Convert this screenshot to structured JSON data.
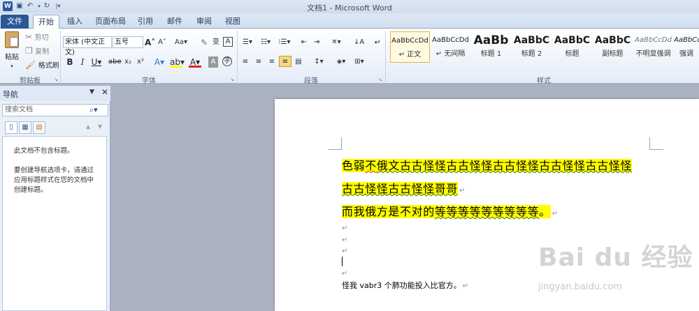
{
  "window": {
    "title": "文档1 - Microsoft Word",
    "app_icon": "W"
  },
  "quick_access": [
    "save-icon",
    "undo-icon",
    "redo-icon",
    "customize-icon"
  ],
  "tabs": [
    {
      "label": "文件"
    },
    {
      "label": "开始"
    },
    {
      "label": "插入"
    },
    {
      "label": "页面布局"
    },
    {
      "label": "引用"
    },
    {
      "label": "邮件"
    },
    {
      "label": "审阅"
    },
    {
      "label": "视图"
    }
  ],
  "clipboard": {
    "paste": "粘贴",
    "cut": "剪切",
    "copy": "复制",
    "format_painter": "格式刷",
    "group": "剪贴板"
  },
  "font": {
    "name": "宋体 (中文正文)",
    "size": "五号",
    "group": "字体"
  },
  "paragraph": {
    "group": "段落"
  },
  "styles": {
    "group": "样式",
    "items": [
      {
        "sample": "AaBbCcDd",
        "name": "↵ 正文"
      },
      {
        "sample": "AaBbCcDd",
        "name": "↵ 无间隔"
      },
      {
        "sample": "AaBb",
        "name": "标题 1"
      },
      {
        "sample": "AaBbC",
        "name": "标题 2"
      },
      {
        "sample": "AaBbC",
        "name": "标题"
      },
      {
        "sample": "AaBbC",
        "name": "副标题"
      },
      {
        "sample": "AaBbCcDd",
        "name": "不明显强调"
      },
      {
        "sample": "AaBbCcDd",
        "name": "强调"
      }
    ]
  },
  "nav": {
    "title": "导航",
    "search_placeholder": "搜索文档",
    "msg1": "此文档不包含标题。",
    "msg2": "要创建导航选项卡，请通过应用标题样式在您的文档中创建标题。"
  },
  "document": {
    "line1_a": "色弱",
    "line1_b": "不",
    "line1_c": "俄文古古怪怪古古怪怪古古怪怪古古怪怪古古怪怪",
    "line2": "古古怪怪古古怪怪哥哥",
    "line3_a": "而我俄方是不对的",
    "line3_b": "等等等等等等等等等",
    "line3_c": "。",
    "line4": "怪我 vabr3 个肺功能投入比官方。",
    "para_mark": "↵"
  },
  "watermark": {
    "brand": "Bai du 经验",
    "url": "jingyan.baidu.com"
  }
}
